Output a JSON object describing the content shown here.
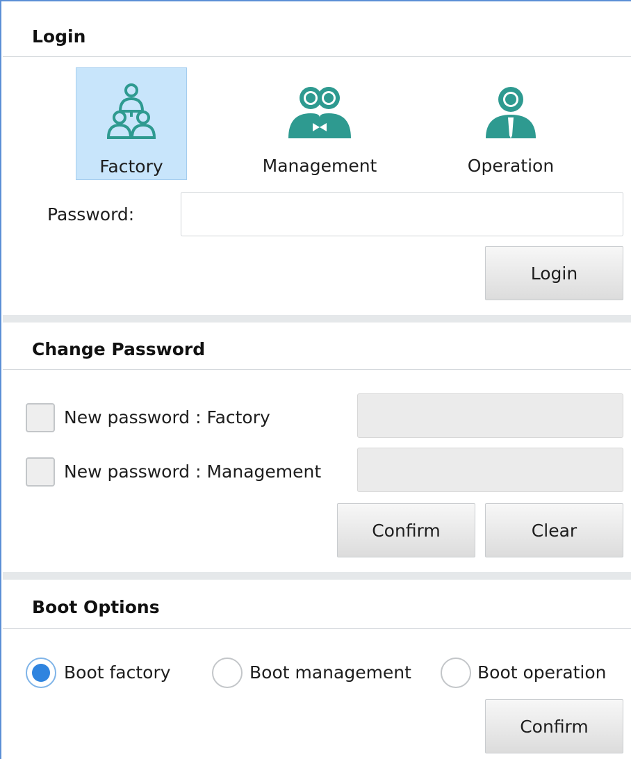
{
  "login": {
    "title": "Login",
    "users": [
      {
        "label": "Factory",
        "icon": "factory-users-icon",
        "selected": true
      },
      {
        "label": "Management",
        "icon": "management-users-icon",
        "selected": false
      },
      {
        "label": "Operation",
        "icon": "operation-user-icon",
        "selected": false
      }
    ],
    "password_label": "Password:",
    "password_value": "",
    "login_button": "Login"
  },
  "change_password": {
    "title": "Change Password",
    "rows": [
      {
        "label": "New password : Factory",
        "checked": false
      },
      {
        "label": "New password : Management",
        "checked": false
      }
    ],
    "confirm_button": "Confirm",
    "clear_button": "Clear"
  },
  "boot": {
    "title": "Boot Options",
    "options": [
      {
        "label": "Boot factory",
        "checked": true
      },
      {
        "label": "Boot management",
        "checked": false
      },
      {
        "label": "Boot operation",
        "checked": false
      }
    ],
    "confirm_button": "Confirm"
  },
  "colors": {
    "accent": "#2f84df",
    "icon_teal": "#2e9a90",
    "selected_tile": "#c8e5fb",
    "frame_border": "#5b8fd6"
  }
}
